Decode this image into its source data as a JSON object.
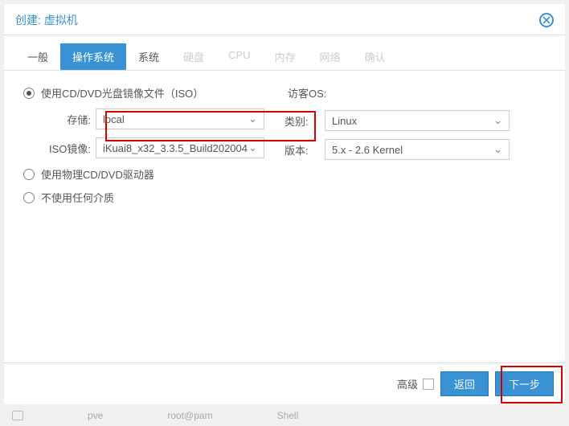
{
  "header": {
    "title": "创建: 虚拟机"
  },
  "tabs": {
    "general": "一般",
    "os": "操作系统",
    "system": "系统",
    "disk": "硬盘",
    "cpu": "CPU",
    "memory": "内存",
    "network": "网络",
    "confirm": "确认"
  },
  "radios": {
    "use_iso": "使用CD/DVD光盘镜像文件（ISO）",
    "use_physical": "使用物理CD/DVD驱动器",
    "use_none": "不使用任何介质"
  },
  "iso_form": {
    "storage_label": "存储:",
    "storage_value": "local",
    "image_label": "ISO镜像:",
    "image_value": "iKuai8_x32_3.3.5_Build202004"
  },
  "guest": {
    "title": "访客OS:",
    "category_label": "类别:",
    "category_value": "Linux",
    "version_label": "版本:",
    "version_value": "5.x - 2.6 Kernel"
  },
  "footer": {
    "advanced": "高级",
    "back": "返回",
    "next": "下一步"
  },
  "bottombar": {
    "item1": "pve",
    "item2": "root@pam",
    "item3": "Shell"
  }
}
